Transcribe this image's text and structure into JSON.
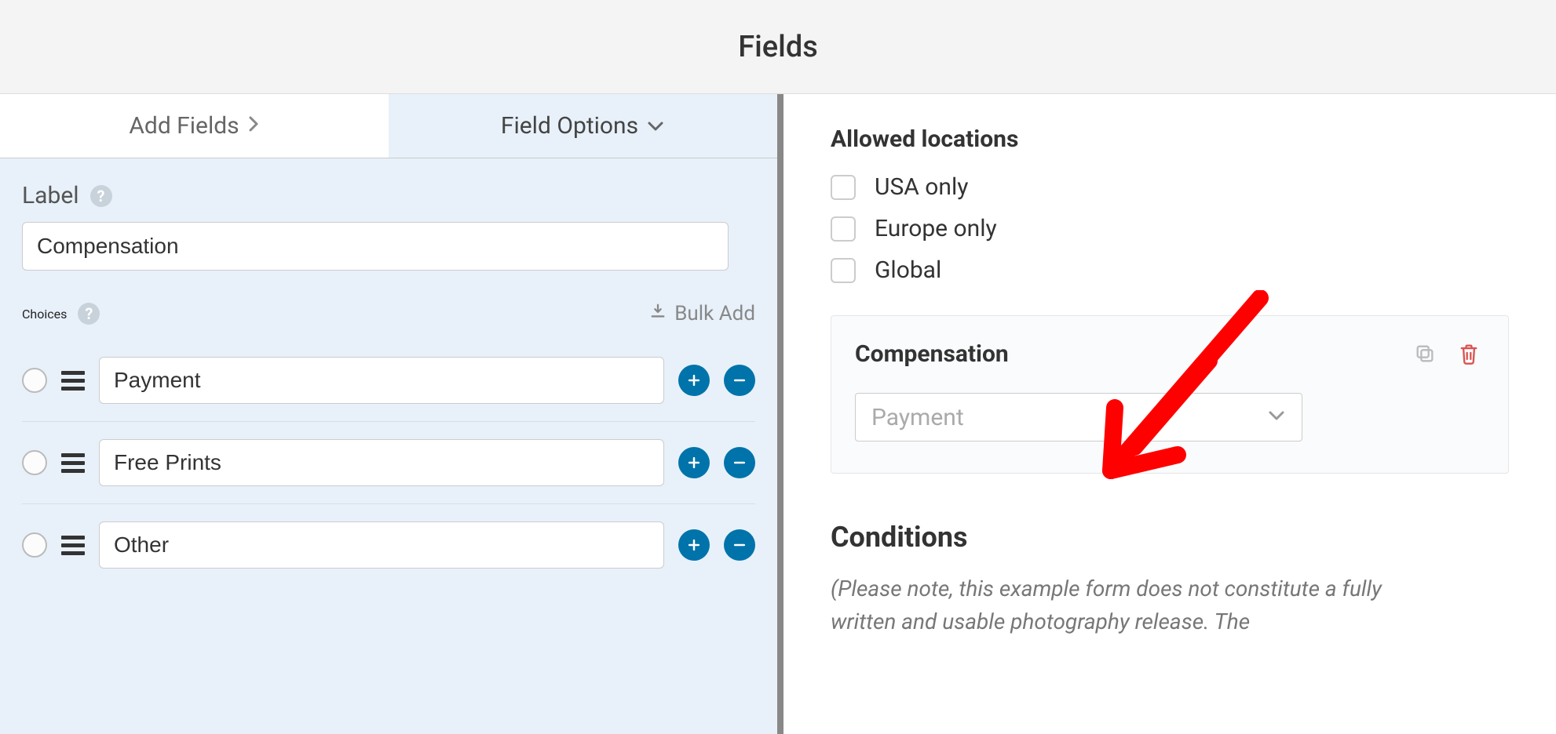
{
  "header": {
    "title": "Fields"
  },
  "tabs": {
    "add_fields": "Add Fields",
    "field_options": "Field Options"
  },
  "field_options": {
    "label_heading": "Label",
    "label_value": "Compensation",
    "choices_heading": "Choices",
    "bulk_add": "Bulk Add",
    "choices": [
      {
        "label": "Payment"
      },
      {
        "label": "Free Prints"
      },
      {
        "label": "Other"
      }
    ]
  },
  "preview": {
    "allowed_locations_title": "Allowed locations",
    "location_options": [
      {
        "label": "USA only"
      },
      {
        "label": "Europe only"
      },
      {
        "label": "Global"
      }
    ],
    "compensation_title": "Compensation",
    "compensation_selected": "Payment",
    "conditions_title": "Conditions",
    "conditions_note": "(Please note, this example form does not constitute a fully written and usable photography release. The"
  }
}
